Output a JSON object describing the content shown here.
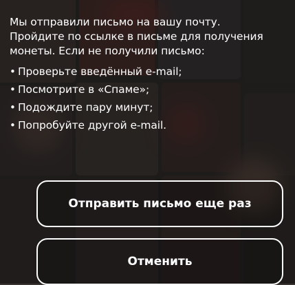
{
  "dialog": {
    "message": "Мы отправили письмо на вашу почту.\nПройдите по ссылке в письме для получения монеты. Если не получили письмо:",
    "tips": [
      "Проверьте введённый e-mail;",
      "Посмотрите в «Спаме»;",
      "Подождите пару минут;",
      "Попробуйте другой e-mail."
    ],
    "bullet": "•",
    "resend_label": "Отправить письмо еще раз",
    "cancel_label": "Отменить"
  },
  "colors": {
    "text": "#ffffff",
    "overlay": "#1a1616",
    "button_border": "#ffffff"
  }
}
